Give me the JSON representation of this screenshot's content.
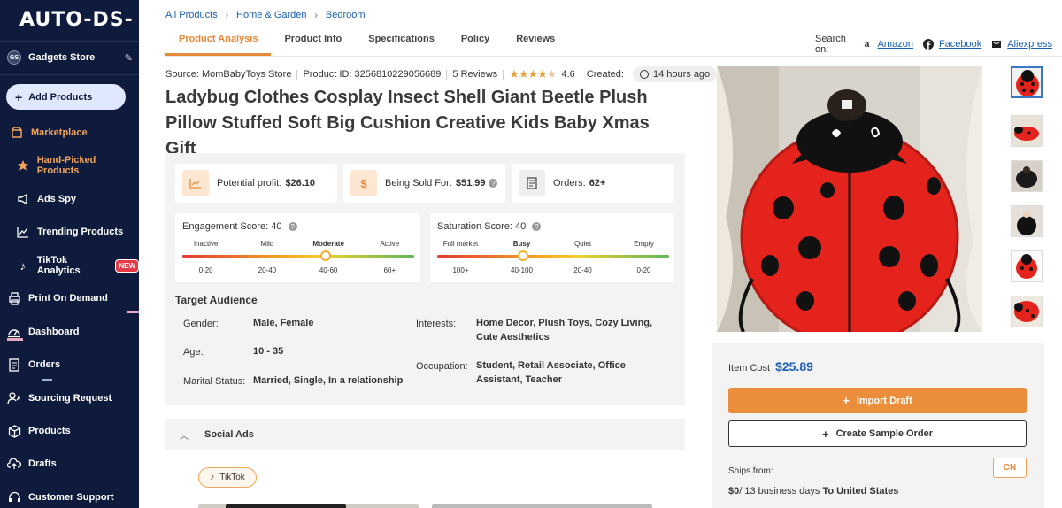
{
  "app": {
    "logo_text": "AUTO-DS-"
  },
  "sidebar": {
    "store_initials": "GS",
    "store_name": "Gadgets Store",
    "add_products_label": "Add Products",
    "items": [
      {
        "label": "Marketplace",
        "icon": "marketplace-icon"
      },
      {
        "label": "Hand-Picked Products",
        "icon": "star-icon"
      },
      {
        "label": "Ads Spy",
        "icon": "megaphone-icon"
      },
      {
        "label": "Trending Products",
        "icon": "trending-icon"
      },
      {
        "label": "TikTok Analytics",
        "icon": "tiktok-icon",
        "badge": "NEW"
      },
      {
        "label": "Print On Demand",
        "icon": "print-icon"
      },
      {
        "label": "Dashboard",
        "icon": "dashboard-icon"
      },
      {
        "label": "Orders",
        "icon": "orders-icon"
      },
      {
        "label": "Sourcing Request",
        "icon": "sourcing-icon"
      },
      {
        "label": "Products",
        "icon": "box-icon"
      },
      {
        "label": "Drafts",
        "icon": "upload-cloud-icon"
      },
      {
        "label": "Customer Support",
        "icon": "headset-icon"
      }
    ]
  },
  "breadcrumb": [
    "All Products",
    "Home & Garden",
    "Bedroom"
  ],
  "tabs": [
    "Product Analysis",
    "Product Info",
    "Specifications",
    "Policy",
    "Reviews"
  ],
  "search_on": {
    "label": "Search on:",
    "sources": [
      "Amazon",
      "Facebook",
      "Aliexpress"
    ]
  },
  "product": {
    "source": "Source: MomBabyToys Store",
    "product_id": "Product ID: 3256810229056689",
    "reviews": "5 Reviews",
    "rating": "4.6",
    "stars": 4.6,
    "created_label": "Created:",
    "created_value": "14 hours ago",
    "title": "Ladybug Clothes Cosplay Insect Shell Giant Beetle Plush Pillow Stuffed Soft Big Cushion Creative Kids Baby Xmas Gift"
  },
  "stats": {
    "profit_label": "Potential profit:",
    "profit_value": "$26.10",
    "sold_label": "Being Sold For:",
    "sold_value": "$51.99",
    "orders_label": "Orders:",
    "orders_value": "62+"
  },
  "engagement": {
    "label": "Engagement Score:",
    "value": "40",
    "levels": [
      "Inactive",
      "Mild",
      "Moderate",
      "Active"
    ],
    "ranges": [
      "0-20",
      "20-40",
      "40-60",
      "60+"
    ],
    "level_fraction": 0.62
  },
  "saturation": {
    "label": "Saturation Score:",
    "value": "40",
    "levels": [
      "Full market",
      "Busy",
      "Quiet",
      "Empty"
    ],
    "ranges": [
      "100+",
      "40-100",
      "20-40",
      "0-20"
    ],
    "level_fraction": 0.37
  },
  "target_audience": {
    "title": "Target Audience",
    "gender_label": "Gender:",
    "gender_value": "Male, Female",
    "age_label": "Age:",
    "age_value": "10 - 35",
    "marital_label": "Marital Status:",
    "marital_value": "Married, Single, In a relationship",
    "interests_label": "Interests:",
    "interests_value": "Home Decor, Plush Toys, Cozy Living, Cute Aesthetics",
    "occupation_label": "Occupation:",
    "occupation_value": "Student, Retail Associate, Office Assistant, Teacher"
  },
  "social_ads": {
    "label": "Social Ads",
    "chip": "TikTok"
  },
  "pricing": {
    "item_cost_label": "Item Cost",
    "item_cost_value": "$25.89",
    "import_label": "Import Draft",
    "sample_label": "Create Sample Order",
    "ships_from_label": "Ships from:",
    "ships_from_value": "CN",
    "shipping_price": "$0",
    "shipping_days": "/ 13 business days",
    "shipping_dest": "To United States"
  },
  "colors": {
    "accent": "#ea8e3b",
    "link": "#1a5fb4",
    "sidebar": "#0f1b3d",
    "ladybug_red": "#e3231c"
  }
}
